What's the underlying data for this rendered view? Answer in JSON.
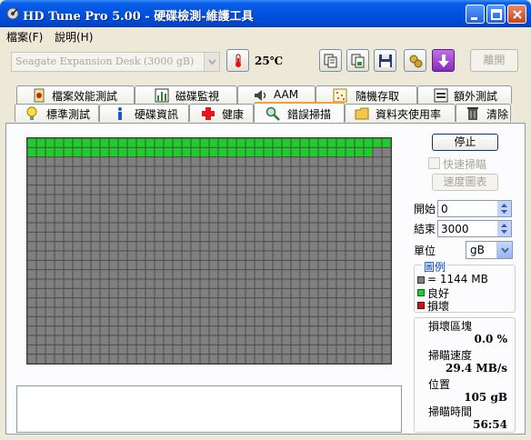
{
  "window": {
    "title": "HD Tune Pro  5.00 - 硬碟檢測-維護工具"
  },
  "menu": {
    "items": [
      "檔案(F)",
      "說明(H)"
    ]
  },
  "toolbar": {
    "drive_value": "Seagate Expansion Desk  (3000 gB)",
    "temperature": "25℃",
    "exit_label": "離開"
  },
  "tabs": {
    "top": [
      "檔案效能測試",
      "磁碟監視",
      "AAM",
      "隨機存取",
      "額外測試"
    ],
    "bottom": [
      "標準測試",
      "硬碟資訊",
      "健康",
      "錯誤掃描",
      "資料夾使用率",
      "清除"
    ]
  },
  "scan": {
    "stop_label": "停止",
    "quick_scan_label": "快速掃瞄",
    "speed_map_label": "速度圖表",
    "start_label": "開始",
    "start_value": "0",
    "end_label": "結束",
    "end_value": "3000",
    "unit_label": "單位",
    "unit_value": "gB",
    "grid_cols": 40,
    "grid_rows": 24,
    "green_cells": 78,
    "colors": {
      "pending": "#808080",
      "good": "#1ecc2a",
      "bad": "#cc1111"
    }
  },
  "legend": {
    "title": "圖例",
    "block_size": "= 1144 MB",
    "good": "良好",
    "damaged": "損壞"
  },
  "stats": {
    "damaged_label": "損壞區塊",
    "damaged_value": "0.0 %",
    "speed_label": "掃瞄速度",
    "speed_value": "29.4 MB/s",
    "position_label": "位置",
    "position_value": "105 gB",
    "time_label": "掃瞄時間",
    "time_value": "56:54"
  }
}
